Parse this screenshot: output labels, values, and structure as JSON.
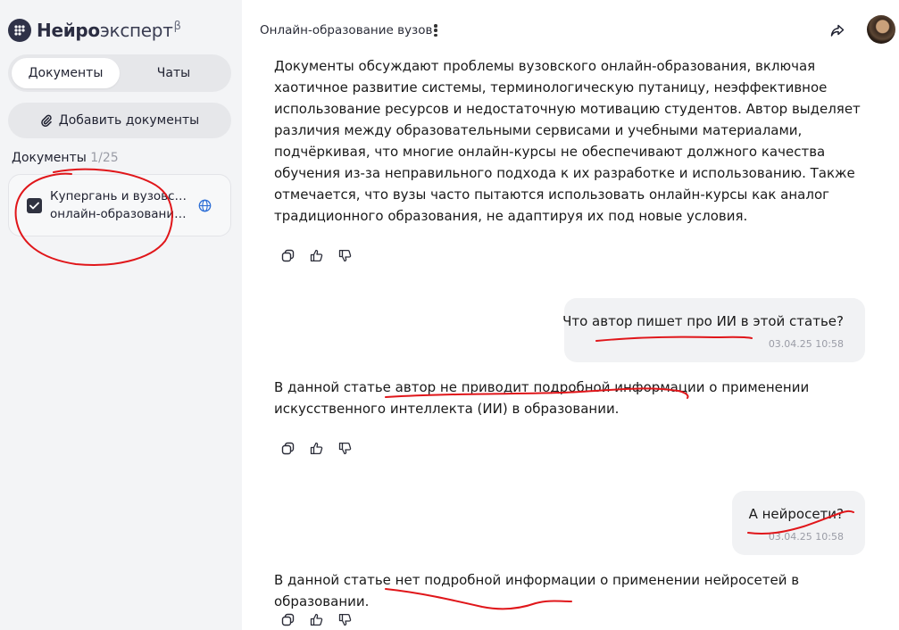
{
  "app": {
    "logo_bold": "Нейро",
    "logo_light": "эксперт",
    "logo_sup": "β"
  },
  "sidebar": {
    "tabs": [
      {
        "label": "Документы",
        "active": true
      },
      {
        "label": "Чаты",
        "active": false
      }
    ],
    "add_button_label": "Добавить документы",
    "documents_label": "Документы",
    "documents_count": "1/25",
    "document": {
      "title_line1": "Купергань и вузовское",
      "title_line2": "онлайн-образование...",
      "checked": true
    }
  },
  "header": {
    "title": "Онлайн-образование вузов"
  },
  "chat": {
    "answer1": "Документы обсуждают проблемы вузовского онлайн-образования, включая хаотичное развитие системы, терминологическую путаницу, неэффективное использование ресурсов и недостаточную мотивацию студентов. Автор выделяет различия между образовательными сервисами и учебными материалами, подчёркивая, что многие онлайн-курсы не обеспечивают должного качества обучения из-за неправильного подхода к их разработке и использованию. Также отмечается, что вузы часто пытаются использовать онлайн-курсы как аналог традиционного образования, не адаптируя их под новые условия.",
    "question1": "Что автор пишет про ИИ в этой статье?",
    "question1_time": "03.04.25 10:58",
    "answer2": "В данной статье автор не приводит подробной информации о применении искусственного интеллекта (ИИ) в образовании.",
    "question2": "А нейросети?",
    "question2_time": "03.04.25 10:58",
    "answer3": "В данной статье нет подробной информации о применении нейросетей в образовании."
  },
  "colors": {
    "sidebar_bg": "#f3f4f6",
    "annotation_red": "#e0161a",
    "globe_blue": "#2e6fd6"
  },
  "icons": [
    "logo-icon",
    "paperclip-icon",
    "checkbox-icon",
    "globe-icon",
    "more-icon",
    "share-icon",
    "copy-icon",
    "thumb-up-icon",
    "thumb-down-icon"
  ]
}
